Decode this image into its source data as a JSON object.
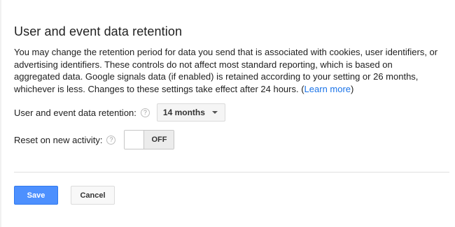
{
  "section": {
    "title": "User and event data retention",
    "description": "You may change the retention period for data you send that is associated with cookies, user identifiers, or advertising identifiers. These controls do not affect most standard reporting, which is based on aggregated data. Google signals data (if enabled) is retained according to your setting or 26 months, whichever is less. Changes to these settings take effect after 24 hours. (",
    "learn_more": "Learn more",
    "description_end": ")"
  },
  "retention": {
    "label": "User and event data retention:",
    "help_glyph": "?",
    "selected_value": "14 months"
  },
  "reset": {
    "label": "Reset on new activity:",
    "help_glyph": "?",
    "toggle_state": "OFF"
  },
  "actions": {
    "save_label": "Save",
    "cancel_label": "Cancel"
  },
  "colors": {
    "primary_button": "#4d90fe",
    "link": "#1a73e8"
  }
}
